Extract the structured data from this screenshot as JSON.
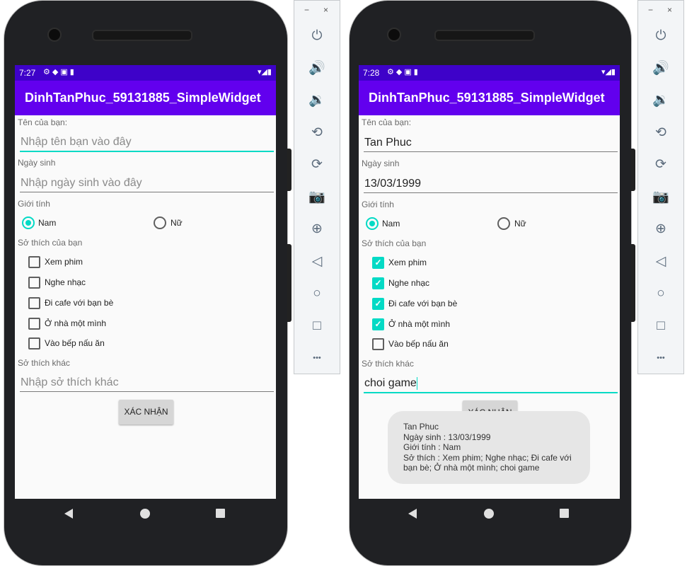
{
  "emulators": [
    {
      "status_time": "7:27",
      "app_title": "DinhTanPhuc_59131885_SimpleWidget",
      "name_label": "Tên của bạn:",
      "name_value": "Nhập tên bạn vào đây",
      "name_is_placeholder": true,
      "birth_label": "Ngày sinh",
      "birth_value": "Nhập ngày sinh vào đây",
      "birth_is_placeholder": true,
      "gender_label": "Giới tính",
      "gender_options": [
        "Nam",
        "Nữ"
      ],
      "gender_selected": "Nam",
      "hobby_label": "Sở thích của bạn",
      "hobbies": [
        {
          "label": "Xem phim",
          "checked": false
        },
        {
          "label": "Nghe nhạc",
          "checked": false
        },
        {
          "label": "Đi cafe với bạn bè",
          "checked": false
        },
        {
          "label": "Ở nhà một mình",
          "checked": false
        },
        {
          "label": "Vào bếp nấu ăn",
          "checked": false
        }
      ],
      "other_label": "Sở thích khác",
      "other_value": "Nhập sở thích khác",
      "other_is_placeholder": true,
      "confirm_label": "XÁC NHẬN"
    },
    {
      "status_time": "7:28",
      "app_title": "DinhTanPhuc_59131885_SimpleWidget",
      "name_label": "Tên của bạn:",
      "name_value": "Tan Phuc",
      "name_is_placeholder": false,
      "birth_label": "Ngày sinh",
      "birth_value": "13/03/1999",
      "birth_is_placeholder": false,
      "gender_label": "Giới tính",
      "gender_options": [
        "Nam",
        "Nữ"
      ],
      "gender_selected": "Nam",
      "hobby_label": "Sở thích của bạn",
      "hobbies": [
        {
          "label": "Xem phim",
          "checked": true
        },
        {
          "label": "Nghe nhạc",
          "checked": true
        },
        {
          "label": "Đi cafe với bạn bè",
          "checked": true
        },
        {
          "label": "Ở nhà một mình",
          "checked": true
        },
        {
          "label": "Vào bếp nấu ăn",
          "checked": false
        }
      ],
      "other_label": "Sở thích khác",
      "other_value": "choi game",
      "other_is_placeholder": false,
      "confirm_label": "XÁC NHẬN",
      "toast_lines": [
        "Tan Phuc",
        "Ngày sinh : 13/03/1999",
        "Giới tính : Nam",
        "Sở thích : Xem phim; Nghe nhạc; Đi cafe với",
        "bạn bè; Ở nhà một mình; choi game"
      ]
    }
  ],
  "toolbar": {
    "minimize": "−",
    "close": "×",
    "buttons": [
      {
        "name": "power-icon",
        "glyph": "⏻"
      },
      {
        "name": "volume-up-icon",
        "glyph": "🔊"
      },
      {
        "name": "volume-down-icon",
        "glyph": "🔉"
      },
      {
        "name": "rotate-left-icon",
        "glyph": "⟲"
      },
      {
        "name": "rotate-right-icon",
        "glyph": "⟳"
      },
      {
        "name": "camera-icon",
        "glyph": "📷"
      },
      {
        "name": "zoom-icon",
        "glyph": "⊕"
      },
      {
        "name": "back-icon",
        "glyph": "◁"
      },
      {
        "name": "home-icon",
        "glyph": "○"
      },
      {
        "name": "overview-icon",
        "glyph": "□"
      },
      {
        "name": "more-icon",
        "glyph": "•••"
      }
    ]
  },
  "colors": {
    "status_bar": "#3e02c9",
    "app_bar": "#6200ee",
    "accent": "#03dac5"
  }
}
